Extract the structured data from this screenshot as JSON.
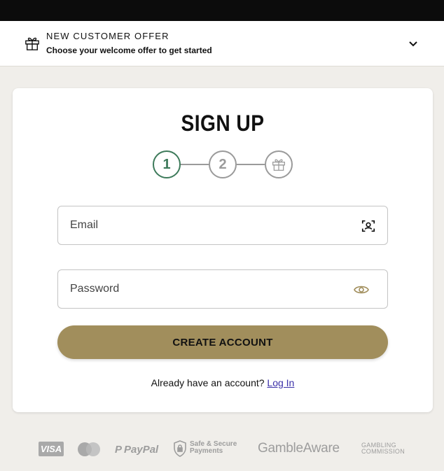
{
  "offer": {
    "title": "NEW CUSTOMER OFFER",
    "subtitle": "Choose your welcome offer to get started"
  },
  "signup": {
    "title": "SIGN UP",
    "steps": [
      "1",
      "2"
    ],
    "active_step": 1,
    "email_placeholder": "Email",
    "password_placeholder": "Password",
    "create_button": "CREATE ACCOUNT",
    "login_prompt": "Already have an account?",
    "login_link": "Log In"
  },
  "footer": {
    "visa": "VISA",
    "paypal": "PayPal",
    "secure_line1": "Safe & Secure",
    "secure_line2": "Payments",
    "gambleaware": "GambleAware",
    "commission_line1": "GAMBLING",
    "commission_line2": "COMMISSION"
  },
  "icons": {
    "offer": "gift-icon",
    "expand": "chevron-down-icon",
    "step3": "gift-icon",
    "email": "face-scan-icon",
    "password": "eye-icon",
    "secure": "shield-lock-icon"
  },
  "colors": {
    "top_bar": "#0c0c0c",
    "page_bg": "#f0eeea",
    "accent_button": "#a18e5c",
    "active_step": "#3d7a5a",
    "inactive_step": "#9a9a9a",
    "link": "#3a2fa8",
    "eye_icon": "#a18e5c"
  }
}
